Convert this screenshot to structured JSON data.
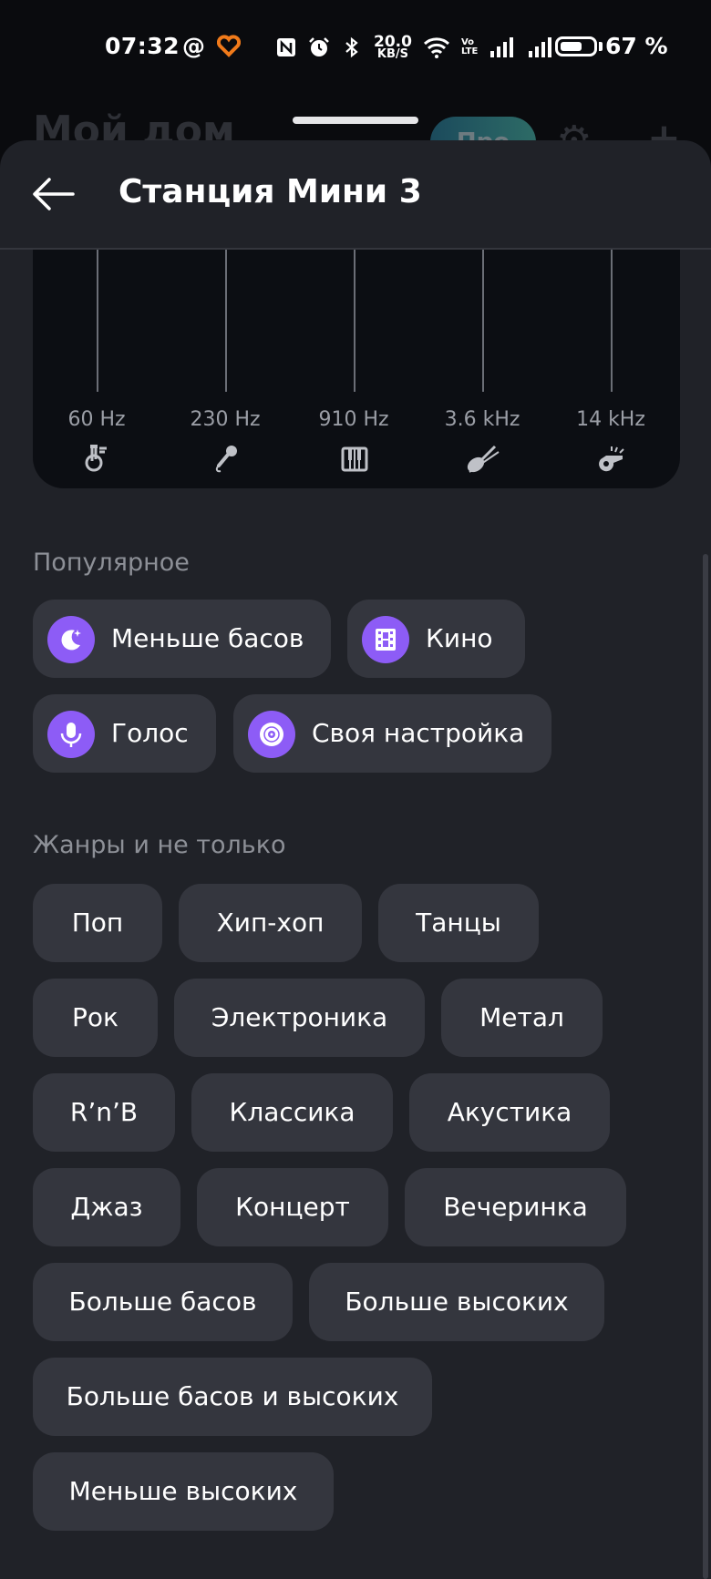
{
  "status": {
    "time": "07:32",
    "at": "@",
    "net_speed_value": "20.0",
    "net_speed_unit": "KB/S",
    "volte_top": "Vo",
    "volte_bottom": "LTE",
    "battery_percent": "67 %",
    "battery_level": 0.67
  },
  "background": {
    "title": "Мой дом",
    "pro_label": "Про"
  },
  "sheet": {
    "title": "Станция Мини 3"
  },
  "equalizer": {
    "bands": [
      {
        "freq": "60 Hz",
        "icon": "tuba-icon"
      },
      {
        "freq": "230 Hz",
        "icon": "microphone-icon"
      },
      {
        "freq": "910 Hz",
        "icon": "piano-keys-icon"
      },
      {
        "freq": "3.6 kHz",
        "icon": "violin-icon"
      },
      {
        "freq": "14 kHz",
        "icon": "whistle-icon"
      }
    ]
  },
  "popular": {
    "title": "Популярное",
    "items": [
      {
        "label": "Меньше басов",
        "icon": "moon-stars-icon"
      },
      {
        "label": "Кино",
        "icon": "film-icon"
      },
      {
        "label": "Голос",
        "icon": "microphone-icon"
      },
      {
        "label": "Своя настройка",
        "icon": "vinyl-disc-icon"
      }
    ]
  },
  "genres": {
    "title": "Жанры и не только",
    "items": [
      "Поп",
      "Хип-хоп",
      "Танцы",
      "Рок",
      "Электроника",
      "Метал",
      "R’n’B",
      "Классика",
      "Акустика",
      "Джаз",
      "Концерт",
      "Вечеринка",
      "Больше басов",
      "Больше высоких",
      "Больше басов и высоких",
      "Меньше высоких"
    ]
  },
  "colors": {
    "accent": "#8d5cf6",
    "sheet_bg": "#202228",
    "chip_bg": "#34363e",
    "eq_bg": "#0c0e13"
  }
}
